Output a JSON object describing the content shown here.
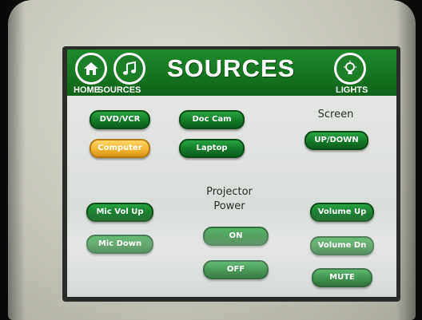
{
  "header": {
    "title": "SOURCES",
    "home_label": "HOME",
    "sources_label": "SOURCES",
    "lights_label": "LIGHTS"
  },
  "sources": {
    "dvd_vcr": "DVD/VCR",
    "doc_cam": "Doc Cam",
    "computer": "Computer",
    "laptop": "Laptop",
    "selected": "Computer"
  },
  "screen": {
    "label": "Screen",
    "up_down": "UP/DOWN"
  },
  "projector": {
    "label_line1": "Projector",
    "label_line2": "Power",
    "on": "ON",
    "off": "OFF"
  },
  "mic": {
    "vol_up": "Mic Vol Up",
    "down": "Mic Down"
  },
  "volume": {
    "up": "Volume Up",
    "down": "Volume Dn",
    "mute": "MUTE"
  },
  "colors": {
    "accent": "#15731f",
    "selected": "#f2b631"
  },
  "icons": [
    "home-icon",
    "music-note-icon",
    "light-bulb-icon"
  ]
}
